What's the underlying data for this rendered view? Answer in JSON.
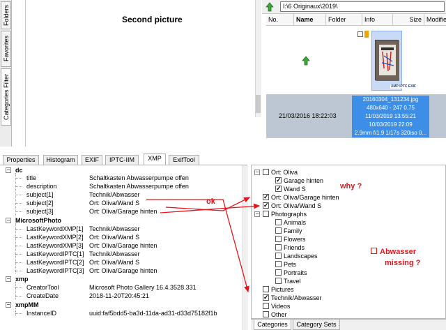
{
  "sidebar": {
    "tabs": [
      {
        "label": "Folders",
        "active": false
      },
      {
        "label": "Favorites",
        "active": false
      },
      {
        "label": "Categories Filter",
        "active": true
      }
    ]
  },
  "preview": {
    "title": "Second picture"
  },
  "browser": {
    "path": "I:\\6 Originaux\\2019\\",
    "columns": [
      "No.",
      "Name",
      "Folder",
      "Info",
      "Size",
      "Modifie"
    ],
    "file": {
      "filename": "20160304_131234.jpg",
      "dimensions": "480x640 - 247 0.75",
      "date1": "11/03/2019 13:55:21",
      "date2": "10/03/2019 22:09",
      "exif": "2.9mm f/1.9 1/17s 320iso 0...",
      "date_taken": "21/03/2016 18:22:03",
      "badges": "XMP IPTC EXIF"
    }
  },
  "meta_tabs": [
    {
      "label": "Properties",
      "active": false
    },
    {
      "label": "Histogram",
      "active": false
    },
    {
      "label": "EXIF",
      "active": false
    },
    {
      "label": "IPTC-IIM",
      "active": false
    },
    {
      "label": "XMP",
      "active": true
    },
    {
      "label": "ExifTool",
      "active": false
    }
  ],
  "metadata": [
    {
      "group": "dc",
      "items": [
        {
          "key": "title",
          "value": "Schaltkasten Abwasserpumpe offen"
        },
        {
          "key": "description",
          "value": "Schaltkasten Abwasserpumpe offen"
        },
        {
          "key": "subject[1]",
          "value": "Technik/Abwasser"
        },
        {
          "key": "subject[2]",
          "value": "Ort: Oliva/Wand S"
        },
        {
          "key": "subject[3]",
          "value": "Ort: Oliva/Garage hinten"
        }
      ]
    },
    {
      "group": "MicrosoftPhoto",
      "items": [
        {
          "key": "LastKeywordXMP[1]",
          "value": "Technik/Abwasser"
        },
        {
          "key": "LastKeywordXMP[2]",
          "value": "Ort: Oliva/Wand S"
        },
        {
          "key": "LastKeywordXMP[3]",
          "value": "Ort: Oliva/Garage hinten"
        },
        {
          "key": "LastKeywordIPTC[1]",
          "value": "Technik/Abwasser"
        },
        {
          "key": "LastKeywordIPTC[2]",
          "value": "Ort: Oliva/Wand S"
        },
        {
          "key": "LastKeywordIPTC[3]",
          "value": "Ort: Oliva/Garage hinten"
        }
      ]
    },
    {
      "group": "xmp",
      "items": [
        {
          "key": "CreatorTool",
          "value": "Microsoft Photo Gallery 16.4.3528.331"
        },
        {
          "key": "CreateDate",
          "value": "2018-11-20T20:45:21"
        }
      ]
    },
    {
      "group": "xmpMM",
      "items": [
        {
          "key": "InstanceID",
          "value": "uuid:faf5bdd5-ba3d-11da-ad31-d33d75182f1b"
        }
      ]
    }
  ],
  "categories": [
    {
      "label": "Ort: Oliva",
      "checked": false,
      "level": 0,
      "expander": true
    },
    {
      "label": "Garage hinten",
      "checked": true,
      "level": 1,
      "expander": false
    },
    {
      "label": "Wand S",
      "checked": true,
      "level": 1,
      "expander": false
    },
    {
      "label": "Ort: Oliva/Garage hinten",
      "checked": true,
      "level": 0,
      "expander": false
    },
    {
      "label": "Ort: Oliva/Wand S",
      "checked": true,
      "level": 0,
      "expander": false
    },
    {
      "label": "Photographs",
      "checked": false,
      "level": 0,
      "expander": true
    },
    {
      "label": "Animals",
      "checked": false,
      "level": 1,
      "expander": false
    },
    {
      "label": "Family",
      "checked": false,
      "level": 1,
      "expander": false
    },
    {
      "label": "Flowers",
      "checked": false,
      "level": 1,
      "expander": false
    },
    {
      "label": "Friends",
      "checked": false,
      "level": 1,
      "expander": false
    },
    {
      "label": "Landscapes",
      "checked": false,
      "level": 1,
      "expander": false
    },
    {
      "label": "Pets",
      "checked": false,
      "level": 1,
      "expander": false
    },
    {
      "label": "Portraits",
      "checked": false,
      "level": 1,
      "expander": false
    },
    {
      "label": "Travel",
      "checked": false,
      "level": 1,
      "expander": false
    },
    {
      "label": "Pictures",
      "checked": false,
      "level": 0,
      "expander": false
    },
    {
      "label": "Technik/Abwasser",
      "checked": true,
      "level": 0,
      "expander": false
    },
    {
      "label": "Videos",
      "checked": false,
      "level": 0,
      "expander": false
    },
    {
      "label": "Other",
      "checked": false,
      "level": 0,
      "expander": false
    }
  ],
  "category_tabs": [
    {
      "label": "Categories",
      "active": true
    },
    {
      "label": "Category Sets",
      "active": false
    }
  ],
  "annotations": {
    "ok": "ok",
    "why": "why ?",
    "missing_line1": "Abwasser",
    "missing_line2": "missing ?",
    "color": "#e8141b"
  }
}
